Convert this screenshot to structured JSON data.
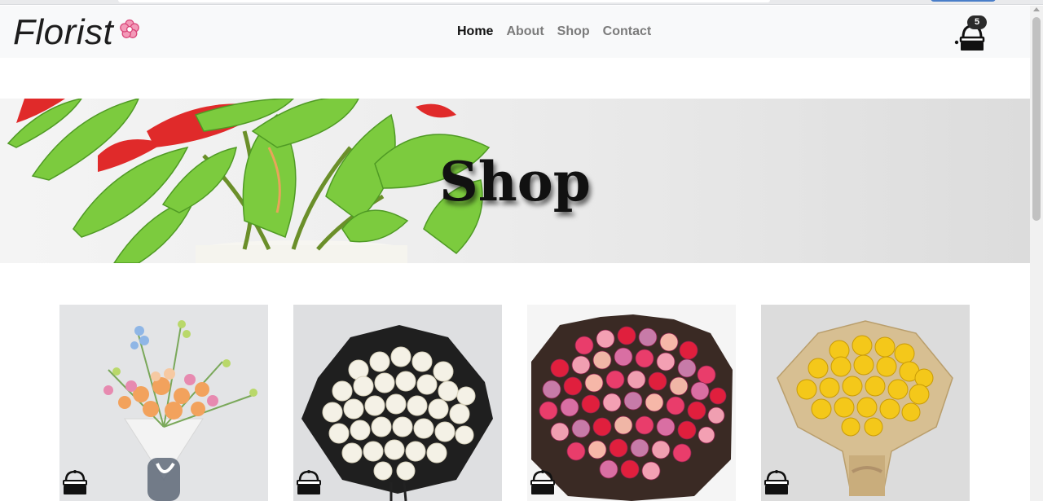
{
  "navbar": {
    "brand": "Florist",
    "links": [
      {
        "label": "Home",
        "active": true
      },
      {
        "label": "About",
        "active": false
      },
      {
        "label": "Shop",
        "active": false
      },
      {
        "label": "Contact",
        "active": false
      }
    ],
    "cart_count": "5",
    "icons": {
      "brand": "flower-icon",
      "cart": "basket-icon"
    }
  },
  "hero": {
    "title": "Shop"
  },
  "products": [
    {
      "image": "mixed-bouquet-photo",
      "icon": "add-to-basket-icon"
    },
    {
      "image": "white-roses-photo",
      "icon": "add-to-basket-icon"
    },
    {
      "image": "pink-red-roses-photo",
      "icon": "add-to-basket-icon"
    },
    {
      "image": "yellow-roses-photo",
      "icon": "add-to-basket-icon"
    }
  ],
  "colors": {
    "navbar_bg": "#f8f9fa",
    "brand_accent": "#e75b8a",
    "text_dark": "#111111",
    "text_muted": "#7b7b7b"
  }
}
